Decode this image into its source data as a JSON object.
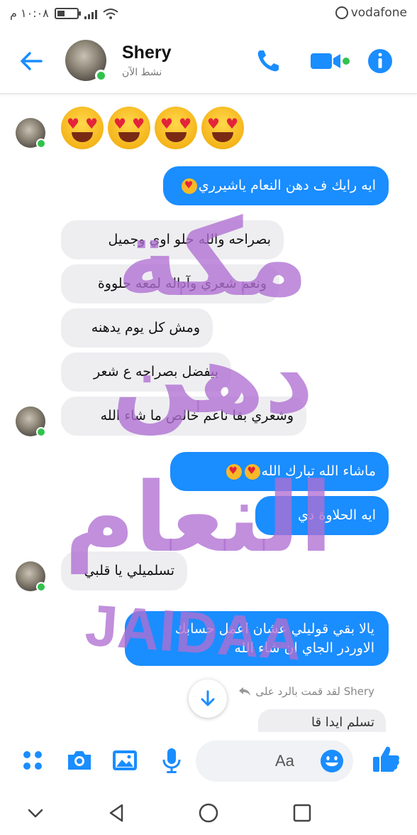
{
  "status_bar": {
    "time": "١٠:٠٨ م",
    "carrier": "vodafone"
  },
  "header": {
    "contact_name": "Shery",
    "active_status": "نشط الآن"
  },
  "messages": [
    {
      "side": "in",
      "text": "😍😍😍😍"
    },
    {
      "side": "out",
      "text": "ايه رايك ف دهن النعام ياشيرري"
    },
    {
      "side": "in",
      "text": "بصراحه والله حلو اوي وجميل"
    },
    {
      "side": "in",
      "text": "ونعم شعري وآداله لمعه حلووة"
    },
    {
      "side": "in",
      "text": "ومش كل يوم يدهنه"
    },
    {
      "side": "in",
      "text": "بيفضل بصراحه ع شعر"
    },
    {
      "side": "in",
      "text": "وشعري بقا ناعم خالص ما شاء الله"
    },
    {
      "side": "out",
      "text": "ماشاء الله تبارك الله"
    },
    {
      "side": "out",
      "text": "ايه الحلاوة دي"
    },
    {
      "side": "in",
      "text": "تسلميلي يا قلبي"
    },
    {
      "side": "out",
      "text": "يالا بقي قوليلي عشان اعمل حسابك الاوردر الجاي ان شاء الله"
    },
    {
      "side": "in",
      "text": "تسلم ايدا قا"
    }
  ],
  "reply_note": "Shery لقد قمت بالرد على",
  "watermark": {
    "line1": "مكة",
    "line2": "دهن",
    "line3": "النعام",
    "line4": "JAIDAA"
  },
  "composer": {
    "placeholder": "Aa"
  },
  "colors": {
    "accent": "#1a8dff",
    "online": "#31c24d",
    "watermark": "#b06fd2"
  },
  "icons": [
    "back-arrow-icon",
    "phone-icon",
    "video-icon",
    "info-icon",
    "apps-icon",
    "camera-icon",
    "gallery-icon",
    "mic-icon",
    "emoji-icon",
    "like-icon",
    "scroll-down-icon",
    "reply-icon"
  ]
}
